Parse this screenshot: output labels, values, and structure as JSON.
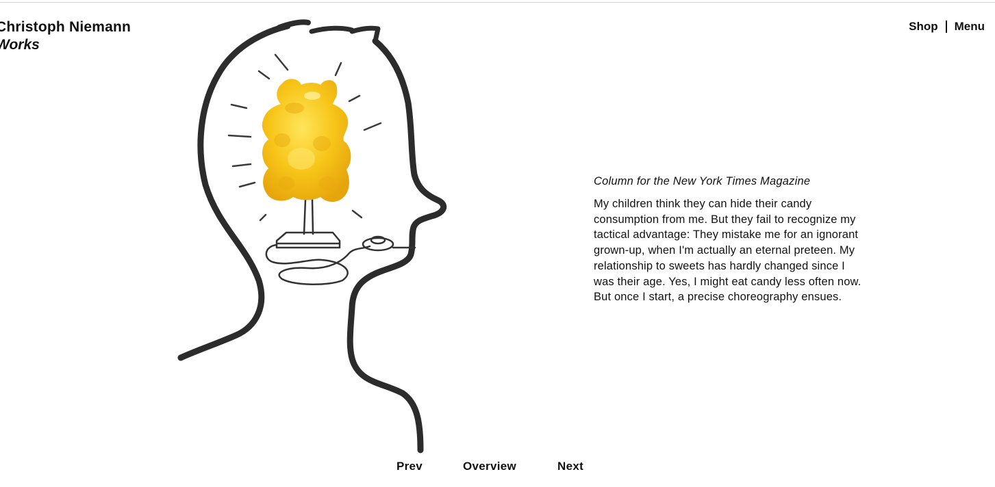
{
  "header": {
    "artist_name": "Christoph Niemann",
    "section": "Works"
  },
  "nav": {
    "shop_label": "Shop",
    "menu_label": "Menu"
  },
  "artwork": {
    "title": "Column for the New York Times Magazine",
    "description": "My children think they can hide their candy consumption from me. But they fail to recognize my tactical advantage: They mistake me for an ignorant grown-up, when I'm actually an eternal preteen. My relationship to sweets has hardly changed since I was their age. Yes, I might eat candy less often now. But once I start, a precise choreography ensues.",
    "gummy_color": "#f7c519",
    "line_color": "#2c2c2c"
  },
  "pager": {
    "prev_label": "Prev",
    "overview_label": "Overview",
    "next_label": "Next"
  }
}
